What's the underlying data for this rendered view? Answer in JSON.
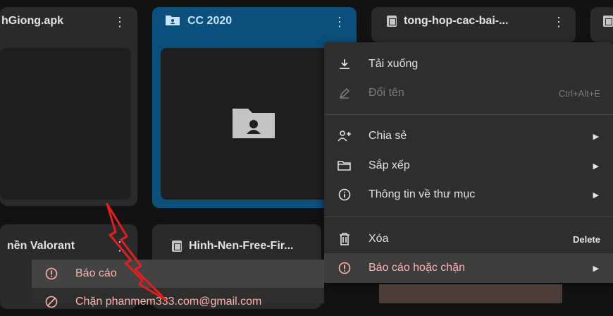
{
  "cards": {
    "c1": {
      "title": "hGiong.apk"
    },
    "c2": {
      "title": "CC 2020"
    },
    "c3": {
      "title": "tong-hop-cac-bai-..."
    },
    "c5": {
      "title": "nền Valorant"
    },
    "c6": {
      "title": "Hinh-Nen-Free-Fir..."
    }
  },
  "menu": {
    "download": "Tải xuống",
    "rename": "Đổi tên",
    "rename_shortcut": "Ctrl+Alt+E",
    "share": "Chia sẻ",
    "organize": "Sắp xếp",
    "info": "Thông tin về thư mục",
    "delete": "Xóa",
    "delete_shortcut": "Delete",
    "report_block": "Báo cáo hoặc chặn"
  },
  "submenu": {
    "report": "Báo cáo",
    "block": "Chặn phanmem333.com@gmail.com"
  },
  "colors": {
    "selected_card": "#0b4f7d",
    "report_text": "#ffb4ab",
    "annotation_arrow": "#e02020"
  }
}
